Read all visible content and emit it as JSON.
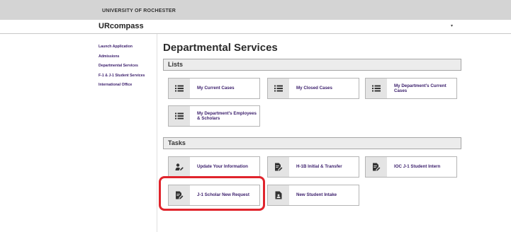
{
  "header": {
    "university": "UNIVERSITY OF ROCHESTER",
    "app_name": "URcompass",
    "caret": "▾"
  },
  "sidebar": {
    "items": [
      {
        "label": "Launch Application"
      },
      {
        "label": "Admissions"
      },
      {
        "label": "Departmental Services"
      },
      {
        "label": "F-1 & J-1 Student Services"
      },
      {
        "label": "International Office"
      }
    ]
  },
  "main": {
    "title": "Departmental Services",
    "lists": {
      "header": "Lists",
      "tiles": [
        {
          "label": "My Current Cases",
          "icon": "list-icon"
        },
        {
          "label": "My Closed Cases",
          "icon": "list-icon"
        },
        {
          "label": "My Department's Current Cases",
          "icon": "list-icon"
        },
        {
          "label": "My Department's Employees & Scholars",
          "icon": "list-icon"
        }
      ]
    },
    "tasks": {
      "header": "Tasks",
      "tiles": [
        {
          "label": "Update Your Information",
          "icon": "user-edit-icon"
        },
        {
          "label": "H-1B Initial & Transfer",
          "icon": "form-edit-icon"
        },
        {
          "label": "IOC J-1 Student Intern",
          "icon": "form-edit-icon"
        },
        {
          "label": "J-1 Scholar New Request",
          "icon": "form-edit-icon"
        },
        {
          "label": "New Student Intake",
          "icon": "document-user-icon"
        }
      ]
    }
  },
  "annotation": {
    "highlight_color": "#e0242c"
  }
}
